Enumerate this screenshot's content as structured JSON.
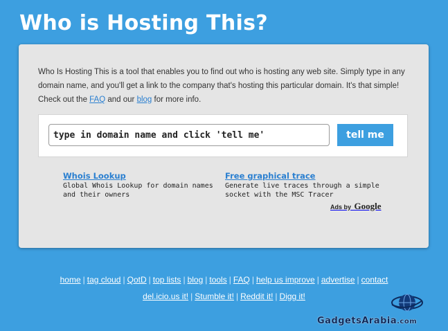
{
  "header": {
    "title": "Who is Hosting This?"
  },
  "intro": {
    "text_1": "Who Is Hosting This is a tool that enables you to find out who is hosting any web site. Simply type in any domain name, and you'll get a link to the company that's hosting this particular domain. It's that simple! Check out the ",
    "faq_link": "FAQ",
    "text_2": " and our ",
    "blog_link": "blog",
    "text_3": " for more info."
  },
  "search": {
    "input_value": "type in domain name and click 'tell me'",
    "button_label": "tell me"
  },
  "ads": [
    {
      "title": "Whois Lookup",
      "description": "Global Whois Lookup for domain names and their owners"
    },
    {
      "title": "Free graphical trace",
      "description": "Generate live traces through a simple socket with the MSC Tracer"
    }
  ],
  "ads_by": {
    "label": "Ads by",
    "logo": "Google"
  },
  "footer": {
    "row1": [
      "home",
      "tag cloud",
      "QotD",
      "top lists",
      "blog",
      "tools",
      "FAQ",
      "help us improve",
      "advertise",
      "contact"
    ],
    "row2": [
      "del.icio.us it!",
      "Stumble it!",
      "Reddit it!",
      "Digg it!"
    ]
  },
  "brand": {
    "name_1": "Gadgets",
    "name_2": "Arabia",
    "suffix": ".com",
    "icon": "globe-icon"
  },
  "colors": {
    "background": "#3d9fe0",
    "panel": "#e5e5e5",
    "link": "#2a7fd0",
    "button": "#3d9fe0"
  }
}
